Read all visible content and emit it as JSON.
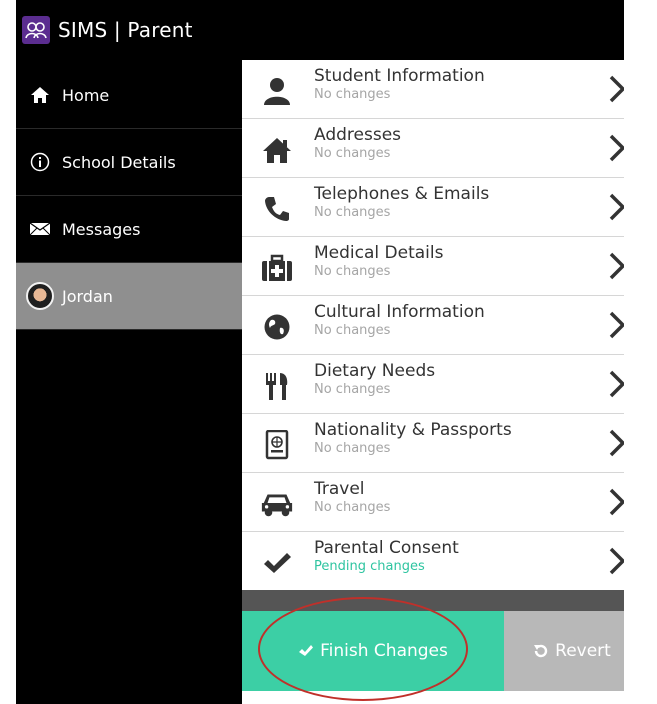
{
  "app": {
    "title": "SIMS | Parent",
    "logo_icon": "sims-logo-icon"
  },
  "sidebar": {
    "items": [
      {
        "label": "Home",
        "icon": "home-icon"
      },
      {
        "label": "School Details",
        "icon": "info-icon"
      },
      {
        "label": "Messages",
        "icon": "envelope-icon"
      },
      {
        "label": "Jordan",
        "icon": "avatar"
      }
    ],
    "active_index": 3
  },
  "panel": {
    "rows": [
      {
        "title": "Student Information",
        "status": "No changes",
        "icon": "person-icon"
      },
      {
        "title": "Addresses",
        "status": "No changes",
        "icon": "house-icon"
      },
      {
        "title": "Telephones & Emails",
        "status": "No changes",
        "icon": "phone-icon"
      },
      {
        "title": "Medical Details",
        "status": "No changes",
        "icon": "medical-kit-icon"
      },
      {
        "title": "Cultural Information",
        "status": "No changes",
        "icon": "globe-icon"
      },
      {
        "title": "Dietary Needs",
        "status": "No changes",
        "icon": "cutlery-icon"
      },
      {
        "title": "Nationality & Passports",
        "status": "No changes",
        "icon": "passport-icon"
      },
      {
        "title": "Travel",
        "status": "No changes",
        "icon": "car-icon"
      },
      {
        "title": "Parental Consent",
        "status": "Pending changes",
        "icon": "checkmark-icon"
      }
    ]
  },
  "footer": {
    "finish_label": "Finish Changes",
    "revert_label": "Revert"
  },
  "colors": {
    "accent_green": "#3ccfa5",
    "pending_text": "#2ec4a0",
    "active_nav": "#8f8f8f",
    "revert_gray": "#b8b8b8",
    "annotation_red": "#c0302a"
  }
}
